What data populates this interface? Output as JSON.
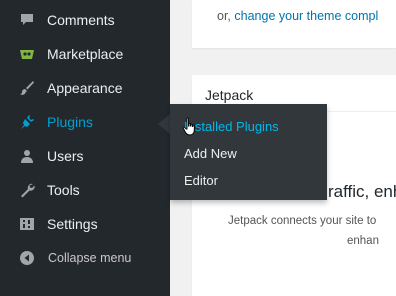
{
  "sidebar": {
    "items": [
      {
        "label": "Comments",
        "icon": "comment-icon"
      },
      {
        "label": "Marketplace",
        "icon": "marketplace-icon"
      },
      {
        "label": "Appearance",
        "icon": "brush-icon"
      },
      {
        "label": "Plugins",
        "icon": "plug-icon",
        "active": true
      },
      {
        "label": "Users",
        "icon": "user-icon"
      },
      {
        "label": "Tools",
        "icon": "wrench-icon"
      },
      {
        "label": "Settings",
        "icon": "settings-icon"
      }
    ],
    "collapse_label": "Collapse menu"
  },
  "flyout": {
    "items": [
      {
        "label": "Installed Plugins",
        "current": true
      },
      {
        "label": "Add New"
      },
      {
        "label": "Editor"
      }
    ]
  },
  "main": {
    "top_text_prefix": "or,",
    "top_link": "change your theme compl",
    "jetpack_title": "Jetpack",
    "headline": "raffic, enh",
    "desc_line1": "Jetpack connects your site to",
    "desc_line2": "enhan"
  },
  "colors": {
    "sidebar_bg": "#23282d",
    "flyout_bg": "#32373c",
    "accent": "#00a0d2",
    "link": "#0073aa"
  }
}
